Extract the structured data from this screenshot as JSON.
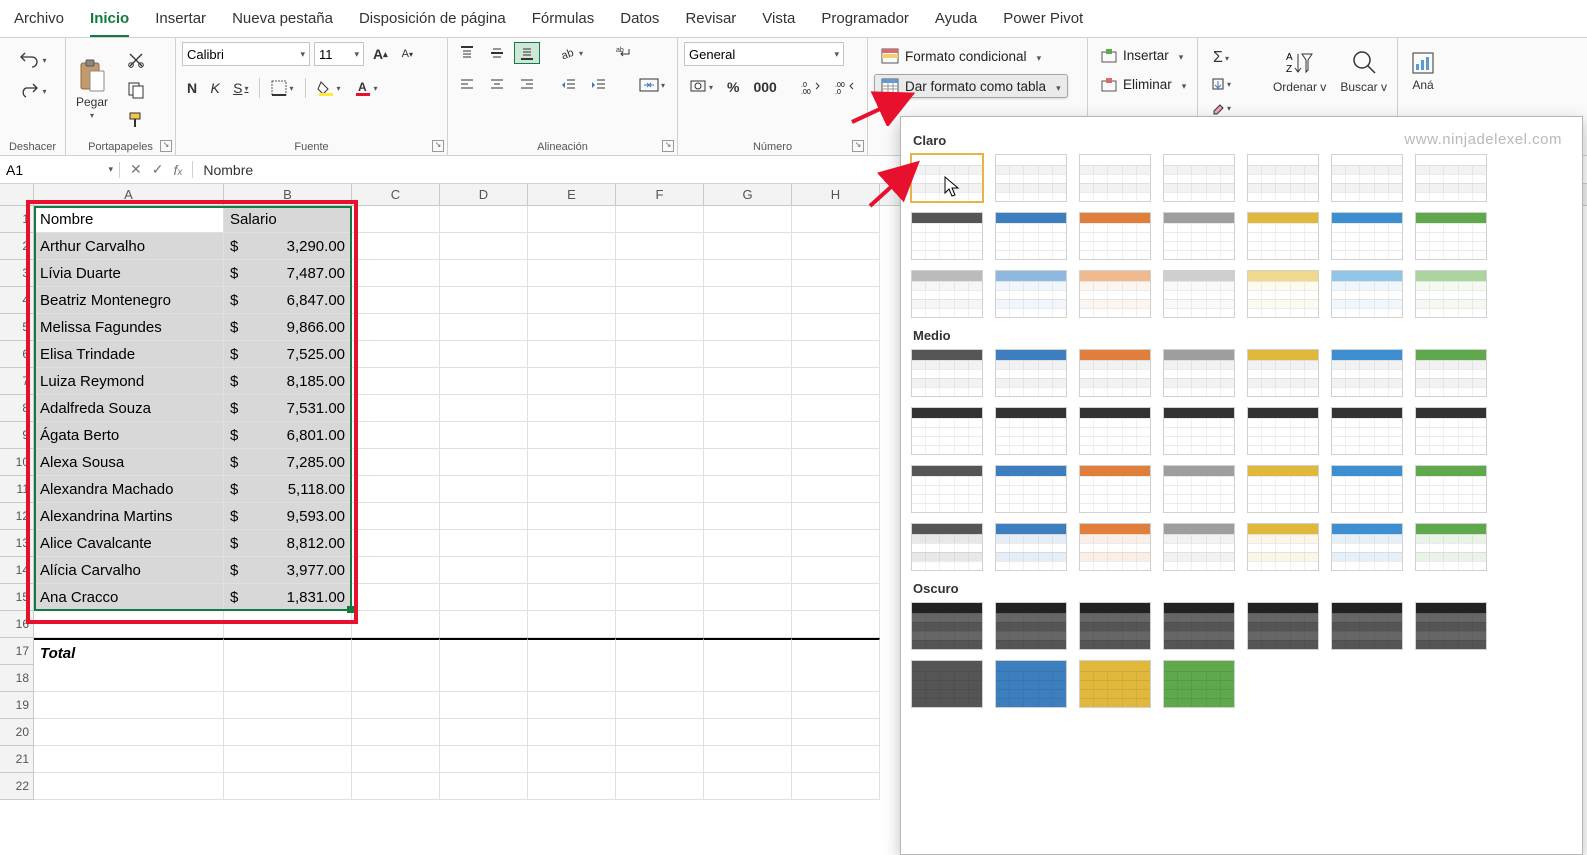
{
  "menuTabs": [
    "Archivo",
    "Inicio",
    "Insertar",
    "Nueva pestaña",
    "Disposición de página",
    "Fórmulas",
    "Datos",
    "Revisar",
    "Vista",
    "Programador",
    "Ayuda",
    "Power Pivot"
  ],
  "activeTab": "Inicio",
  "ribbon": {
    "undo_label": "Deshacer",
    "clipboard_label": "Portapapeles",
    "paste_label": "Pegar",
    "font": {
      "group": "Fuente",
      "name": "Calibri",
      "size": "11",
      "btns": [
        "N",
        "K",
        "S"
      ]
    },
    "align": {
      "group": "Alineación"
    },
    "number": {
      "group": "Número",
      "format": "General"
    },
    "styles": {
      "cond": "Formato condicional",
      "table": "Dar formato como tabla"
    },
    "cells": {
      "insert": "Insertar",
      "delete": "Eliminar"
    },
    "editing": {
      "sort": "Ordenar v",
      "find": "Buscar v"
    },
    "analyze": "Aná"
  },
  "nameBox": "A1",
  "formula": "Nombre",
  "columns": [
    "A",
    "B",
    "C",
    "D",
    "E",
    "F",
    "G",
    "H"
  ],
  "rowsCount": 22,
  "headers": {
    "a": "Nombre",
    "b": "Salario"
  },
  "data": [
    {
      "name": "Arthur Carvalho",
      "sal": "3,290.00"
    },
    {
      "name": "Lívia Duarte",
      "sal": "7,487.00"
    },
    {
      "name": "Beatriz Montenegro",
      "sal": "6,847.00"
    },
    {
      "name": "Melissa Fagundes",
      "sal": "9,866.00"
    },
    {
      "name": "Elisa Trindade",
      "sal": "7,525.00"
    },
    {
      "name": "Luiza Reymond",
      "sal": "8,185.00"
    },
    {
      "name": "Adalfreda Souza",
      "sal": "7,531.00"
    },
    {
      "name": "Ágata Berto",
      "sal": "6,801.00"
    },
    {
      "name": "Alexa Sousa",
      "sal": "7,285.00"
    },
    {
      "name": "Alexandra Machado",
      "sal": "5,118.00"
    },
    {
      "name": "Alexandrina Martins",
      "sal": "9,593.00"
    },
    {
      "name": "Alice Cavalcante",
      "sal": "8,812.00"
    },
    {
      "name": "Alícia Carvalho",
      "sal": "3,977.00"
    },
    {
      "name": "Ana Cracco",
      "sal": "1,831.00"
    }
  ],
  "currencySymbol": "$",
  "totalLabel": "Total",
  "gallery": {
    "watermark": "www.ninjadelexel.com",
    "sections": {
      "light": "Claro",
      "medium": "Medio",
      "dark": "Oscuro"
    },
    "palette": [
      "#555555",
      "#3d7ebf",
      "#e07e3c",
      "#9e9e9e",
      "#e0b83c",
      "#3d8fd1",
      "#5fa84c"
    ],
    "lightPalette": [
      "#bbbbbb",
      "#8fb8e0",
      "#f0b98e",
      "#cfcfcf",
      "#f0d98e",
      "#8fc5e6",
      "#abd49e"
    ]
  }
}
